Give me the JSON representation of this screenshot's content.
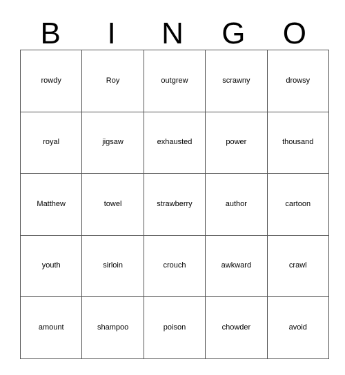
{
  "card": {
    "type": "bingo-card",
    "columns": 5,
    "rows": 5,
    "header": {
      "letters": [
        "B",
        "I",
        "N",
        "G",
        "O"
      ]
    },
    "grid": [
      [
        {
          "word": "rowdy",
          "column": "B"
        },
        {
          "word": "Roy",
          "column": "I"
        },
        {
          "word": "outgrew",
          "column": "N"
        },
        {
          "word": "scrawny",
          "column": "G"
        },
        {
          "word": "drowsy",
          "column": "O"
        }
      ],
      [
        {
          "word": "royal",
          "column": "B"
        },
        {
          "word": "jigsaw",
          "column": "I"
        },
        {
          "word": "exhausted",
          "column": "N"
        },
        {
          "word": "power",
          "column": "G"
        },
        {
          "word": "thousand",
          "column": "O"
        }
      ],
      [
        {
          "word": "Matthew",
          "column": "B"
        },
        {
          "word": "towel",
          "column": "I"
        },
        {
          "word": "strawberry",
          "column": "N"
        },
        {
          "word": "author",
          "column": "G"
        },
        {
          "word": "cartoon",
          "column": "O"
        }
      ],
      [
        {
          "word": "youth",
          "column": "B"
        },
        {
          "word": "sirloin",
          "column": "I"
        },
        {
          "word": "crouch",
          "column": "N"
        },
        {
          "word": "awkward",
          "column": "G"
        },
        {
          "word": "crawl",
          "column": "O"
        }
      ],
      [
        {
          "word": "amount",
          "column": "B"
        },
        {
          "word": "shampoo",
          "column": "I"
        },
        {
          "word": "poison",
          "column": "N"
        },
        {
          "word": "chowder",
          "column": "G"
        },
        {
          "word": "avoid",
          "column": "O"
        }
      ]
    ],
    "colors": {
      "background": "#ffffff",
      "text": "#000000",
      "grid_line": "#555555"
    }
  }
}
